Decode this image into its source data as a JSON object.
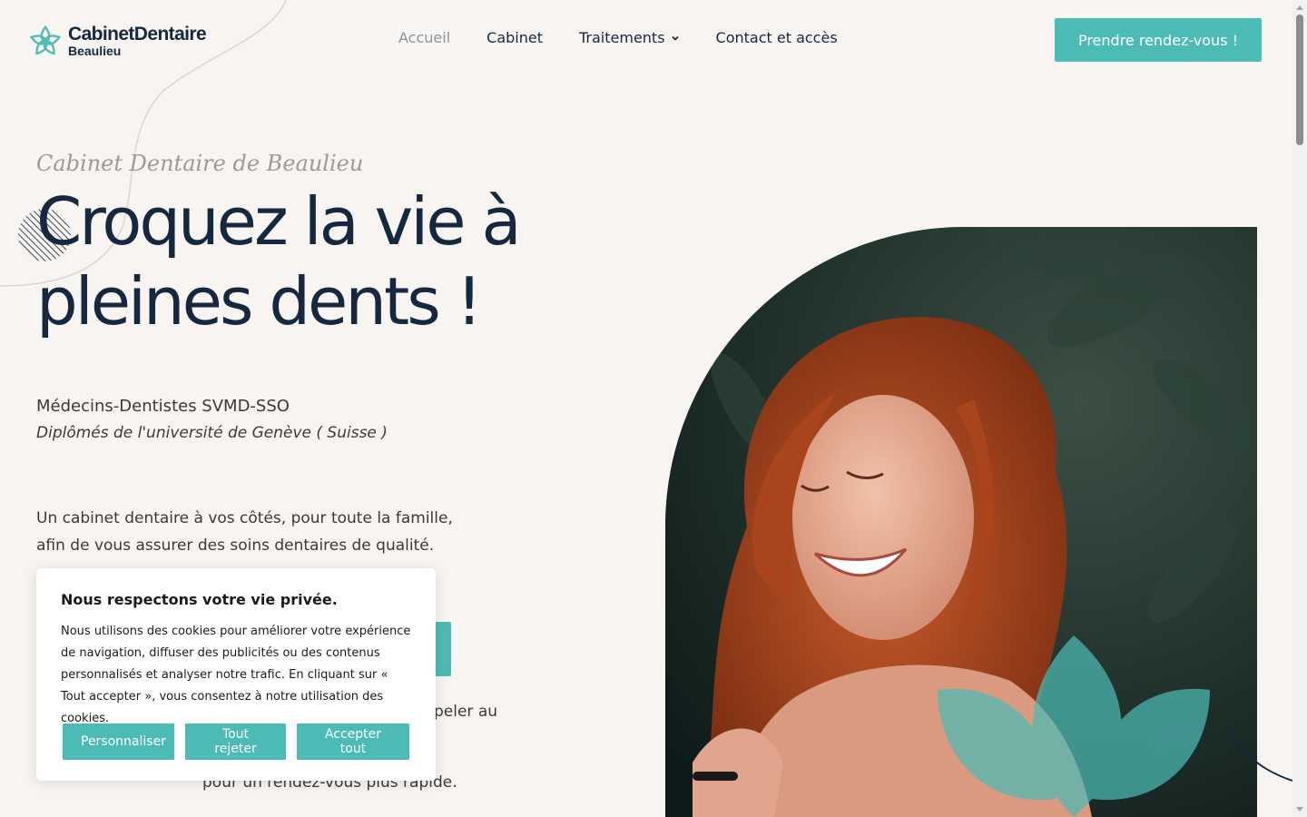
{
  "brand": {
    "name": "CabinetDentaire",
    "sub": "Beaulieu",
    "accent": "#4dbbb5",
    "navy": "#16283f",
    "background": "#f8f4f1"
  },
  "nav": {
    "items": [
      {
        "label": "Accueil",
        "active": true
      },
      {
        "label": "Cabinet",
        "active": false
      },
      {
        "label": "Traitements",
        "active": false,
        "has_dropdown": true
      },
      {
        "label": "Contact et accès",
        "active": false
      }
    ],
    "cta_label": "Prendre rendez-vous !"
  },
  "hero": {
    "eyebrow": "Cabinet Dentaire de Beaulieu",
    "headline_line1": "Croquez la vie à",
    "headline_line2": "pleines dents !",
    "subtitle": "Médecins-Dentistes SVMD-SSO",
    "subtitle_italic": "Diplômés de l'université de Genève ( Suisse )",
    "intro_line1": "Un cabinet dentaire à vos côtés, pour toute la famille,",
    "intro_line2": "afin de vous assurer des soins dentaires de qualité.",
    "call_fragment": "peler au",
    "rdv_fragment": "pour un rendez-vous plus rapide."
  },
  "cookie": {
    "title": "Nous respectons votre vie privée.",
    "text": "Nous utilisons des cookies pour améliorer votre expérience de navigation, diffuser des publicités ou des contenus personnalisés et analyser notre trafic. En cliquant sur « Tout accepter », vous consentez à notre utilisation des cookies.",
    "customize_label": "Personnaliser",
    "reject_label": "Tout rejeter",
    "accept_label": "Accepter tout"
  },
  "icons": {
    "logo": "flower-logo-icon",
    "dropdown": "chevron-down-icon"
  }
}
